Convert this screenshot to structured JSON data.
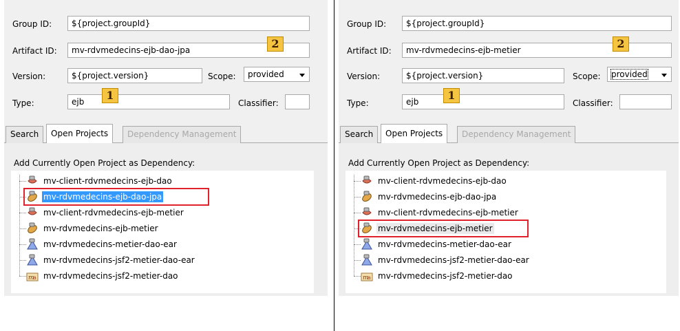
{
  "colors": {
    "badge": "#f5c542",
    "selection": "#3399ff",
    "highlight_box": "#e0212b"
  },
  "left": {
    "group_id_label": "Group ID:",
    "group_id_value": "${project.groupId}",
    "artifact_id_label": "Artifact ID:",
    "artifact_id_value": "mv-rdvmedecins-ejb-dao-jpa",
    "version_label": "Version:",
    "version_value": "${project.version}",
    "scope_label": "Scope:",
    "scope_value": "provided",
    "type_label": "Type:",
    "type_value": "ejb",
    "classifier_label": "Classifier:",
    "classifier_value": "",
    "badge_type": "1",
    "badge_artifact": "2",
    "tabs": [
      "Search",
      "Open Projects",
      "Dependency Management"
    ],
    "heading": "Add Currently Open Project as Dependency:",
    "projects": [
      {
        "label": "mv-client-rdvmedecins-ejb-dao",
        "icon": "client-project-icon"
      },
      {
        "label": "mv-rdvmedecins-ejb-dao-jpa",
        "icon": "ejb-bean-icon"
      },
      {
        "label": "mv-client-rdvmedecins-ejb-metier",
        "icon": "client-project-icon"
      },
      {
        "label": "mv-rdvmedecins-ejb-metier",
        "icon": "ejb-bean-icon"
      },
      {
        "label": "mv-rdvmedecins-metier-dao-ear",
        "icon": "ear-project-icon"
      },
      {
        "label": "mv-rdvmedecins-jsf2-metier-dao-ear",
        "icon": "ear-project-icon"
      },
      {
        "label": "mv-rdvmedecins-jsf2-metier-dao",
        "icon": "maven-war-icon"
      }
    ],
    "selected_index": 1
  },
  "right": {
    "group_id_label": "Group ID:",
    "group_id_value": "${project.groupId}",
    "artifact_id_label": "Artifact ID:",
    "artifact_id_value": "mv-rdvmedecins-ejb-metier",
    "version_label": "Version:",
    "version_value": "${project.version}",
    "scope_label": "Scope:",
    "scope_value": "provided",
    "type_label": "Type:",
    "type_value": "ejb",
    "classifier_label": "Classifier:",
    "classifier_value": "",
    "badge_type": "1",
    "badge_artifact": "2",
    "tabs": [
      "Search",
      "Open Projects",
      "Dependency Management"
    ],
    "heading": "Add Currently Open Project as Dependency:",
    "projects": [
      {
        "label": "mv-client-rdvmedecins-ejb-dao",
        "icon": "client-project-icon"
      },
      {
        "label": "mv-rdvmedecins-ejb-dao-jpa",
        "icon": "ejb-bean-icon"
      },
      {
        "label": "mv-client-rdvmedecins-ejb-metier",
        "icon": "client-project-icon"
      },
      {
        "label": "mv-rdvmedecins-ejb-metier",
        "icon": "ejb-bean-icon"
      },
      {
        "label": "mv-rdvmedecins-metier-dao-ear",
        "icon": "ear-project-icon"
      },
      {
        "label": "mv-rdvmedecins-jsf2-metier-dao-ear",
        "icon": "ear-project-icon"
      },
      {
        "label": "mv-rdvmedecins-jsf2-metier-dao",
        "icon": "maven-war-icon"
      }
    ],
    "selected_index": 3
  }
}
